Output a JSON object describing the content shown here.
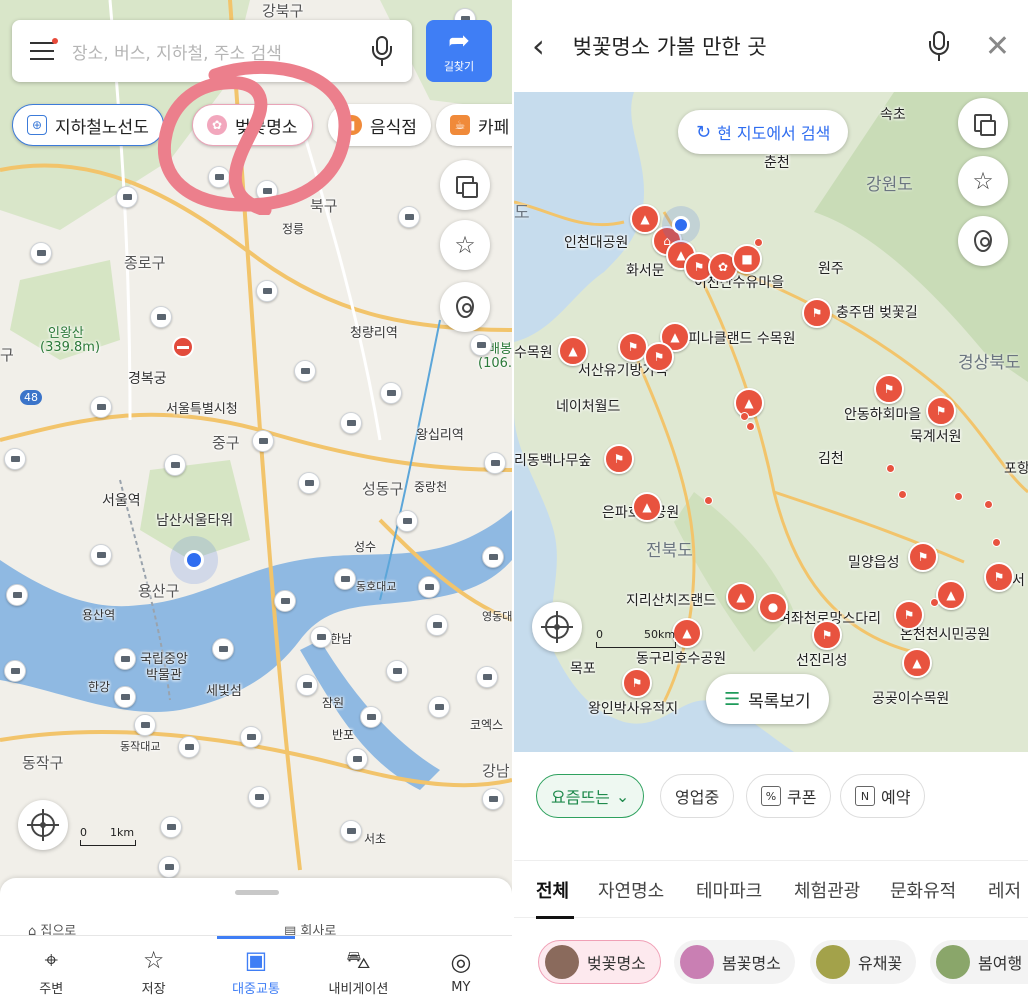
{
  "left": {
    "search": {
      "placeholder": "장소, 버스, 지하철, 주소 검색"
    },
    "directions_label": "길찾기",
    "chips": [
      {
        "label": "지하철노선도",
        "icon": "subway-icon"
      },
      {
        "label": "벚꽃명소",
        "icon": "cherry-blossom-icon"
      },
      {
        "label": "음식점",
        "icon": "restaurant-icon"
      },
      {
        "label": "카페",
        "icon": "cafe-icon"
      }
    ],
    "map_labels": {
      "gangbuk": "강북구",
      "seongbuk": "북구",
      "jongno": "종로구",
      "inwangsan": "인왕산",
      "inwangsan_alt": "(339.8m)",
      "gyeongbokgung": "경복궁",
      "city_hall": "서울특별시청",
      "junggu": "중구",
      "seoul_station": "서울역",
      "namsan_tower": "남산서울타워",
      "yongsan": "용산구",
      "yongsan_station": "용산역",
      "museum": "국립중앙 박물관",
      "hangang": "한강",
      "sebitseom": "세빛섬",
      "dongjak": "동작구",
      "dongjak_bridge": "동작대교",
      "cheongnyangni": "청량리역",
      "wangsimni": "왕십리역",
      "seongdong": "성동구",
      "jungnangcheon": "중랑천",
      "seongsu": "성수",
      "dongho": "동호대교",
      "yeongdong": "영동대",
      "hannam": "한남",
      "jamwon": "잠원",
      "banpo": "반포",
      "coex": "코엑스",
      "gangnam": "강남",
      "seocho": "서초",
      "jeongneung": "정릉",
      "gu": "구",
      "baebong": "배봉",
      "baebong_alt": "(106.0",
      "route48": "48"
    },
    "scale": {
      "zero": "0",
      "dist": "1km"
    },
    "sheet_links": [
      "집으로",
      "회사로"
    ],
    "tabs": [
      {
        "label": "주변",
        "icon": "location-pin-icon",
        "active": false
      },
      {
        "label": "저장",
        "icon": "star-icon",
        "active": false
      },
      {
        "label": "대중교통",
        "icon": "bus-icon",
        "active": true
      },
      {
        "label": "내비게이션",
        "icon": "car-icon",
        "active": false
      },
      {
        "label": "MY",
        "icon": "profile-icon",
        "active": false
      }
    ]
  },
  "right": {
    "title": "벚꽃명소 가볼 만한 곳",
    "refresh_label": "현 지도에서 검색",
    "list_label": "목록보기",
    "scale": {
      "zero": "0",
      "dist": "50km"
    },
    "regions": {
      "gangwon": "강원도",
      "gyeongbuk": "경상북도",
      "jeonbuk": "전북도",
      "do": "도"
    },
    "map_labels": {
      "sokcho": "속초",
      "chuncheon": "춘천",
      "incheon_park": "인천대공원",
      "hwaseomun": "화서문",
      "icheon": "이천산수유마을",
      "wonju": "원주",
      "chungju": "충주댐 벚꽃길",
      "pinacle": "피나클랜드 수목원",
      "arboretum": "수목원",
      "seosan": "서산유기방가옥",
      "nature_world": "네이처월드",
      "andong": "안동하회마을",
      "mukgye": "묵계서원",
      "gimcheon": "김천",
      "baengnamu": "리동백나무숲",
      "pohang": "포항",
      "eunpa": "은파호수공원",
      "miryang": "밀양읍성",
      "jirisan": "지리산치즈랜드",
      "yeojwa": "여좌천로망스다리",
      "oncheoncheon": "온천천시민공원",
      "dongguri": "동구리호수공원",
      "seonjin": "선진리성",
      "mokpo": "목포",
      "wangin": "왕인박사유적지",
      "gonggot": "공곶이수목원",
      "seo": "서"
    },
    "filters": [
      "요즘뜨는",
      "영업중",
      "쿠폰",
      "예약"
    ],
    "categories": [
      "전체",
      "자연명소",
      "테마파크",
      "체험관광",
      "문화유적",
      "레저"
    ],
    "pills": [
      "벚꽃명소",
      "봄꽃명소",
      "유채꽃",
      "봄여행"
    ],
    "colors": {
      "accent": "#2f6df0",
      "poi": "#e8533f",
      "selected_filter": "#2ea15e",
      "annotation": "#ec7f8c"
    }
  }
}
